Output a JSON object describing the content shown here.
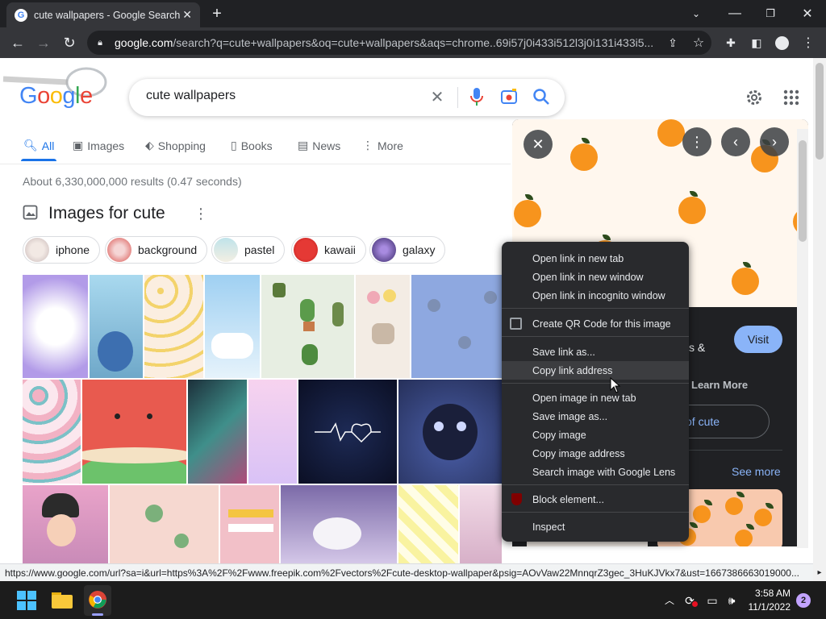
{
  "browser": {
    "tab_title": "cute wallpapers - Google Search",
    "url_host": "google.com",
    "url_path": "/search?q=cute+wallpapers&oq=cute+wallpapers&aqs=chrome..69i57j0i433i512l3j0i131i433i5..."
  },
  "google": {
    "logo": "Google",
    "query": "cute wallpapers",
    "tabs": [
      "All",
      "Images",
      "Shopping",
      "Books",
      "News",
      "More"
    ],
    "results_count": "About 6,330,000,000 results (0.47 seconds)",
    "images_heading": "Images for cute",
    "chips": [
      "iphone",
      "background",
      "pastel",
      "kawaii",
      "galaxy"
    ]
  },
  "panel": {
    "visit_label": "Visit",
    "learn_more": "Learn More",
    "title_fragment": "s &",
    "link_fragment": "of cute",
    "see_more": "See more"
  },
  "context_menu": {
    "items": [
      "Open link in new tab",
      "Open link in new window",
      "Open link in incognito window",
      "Create QR Code for this image",
      "Save link as...",
      "Copy link address",
      "Open image in new tab",
      "Save image as...",
      "Copy image",
      "Copy image address",
      "Search image with Google Lens",
      "Block element...",
      "Inspect"
    ]
  },
  "status_url": "https://www.google.com/url?sa=i&url=https%3A%2F%2Fwww.freepik.com%2Fvectors%2Fcute-desktop-wallpaper&psig=AOvVaw22MnnqrZ3gec_3HuKJVkx7&ust=1667386663019000...",
  "taskbar": {
    "time": "3:58 AM",
    "date": "11/1/2022",
    "notification_count": "2"
  },
  "colors": {
    "accent": "#1a73e8",
    "chrome_dark": "#202124",
    "menu_bg": "#292a2d",
    "orange": "#f7941d"
  }
}
